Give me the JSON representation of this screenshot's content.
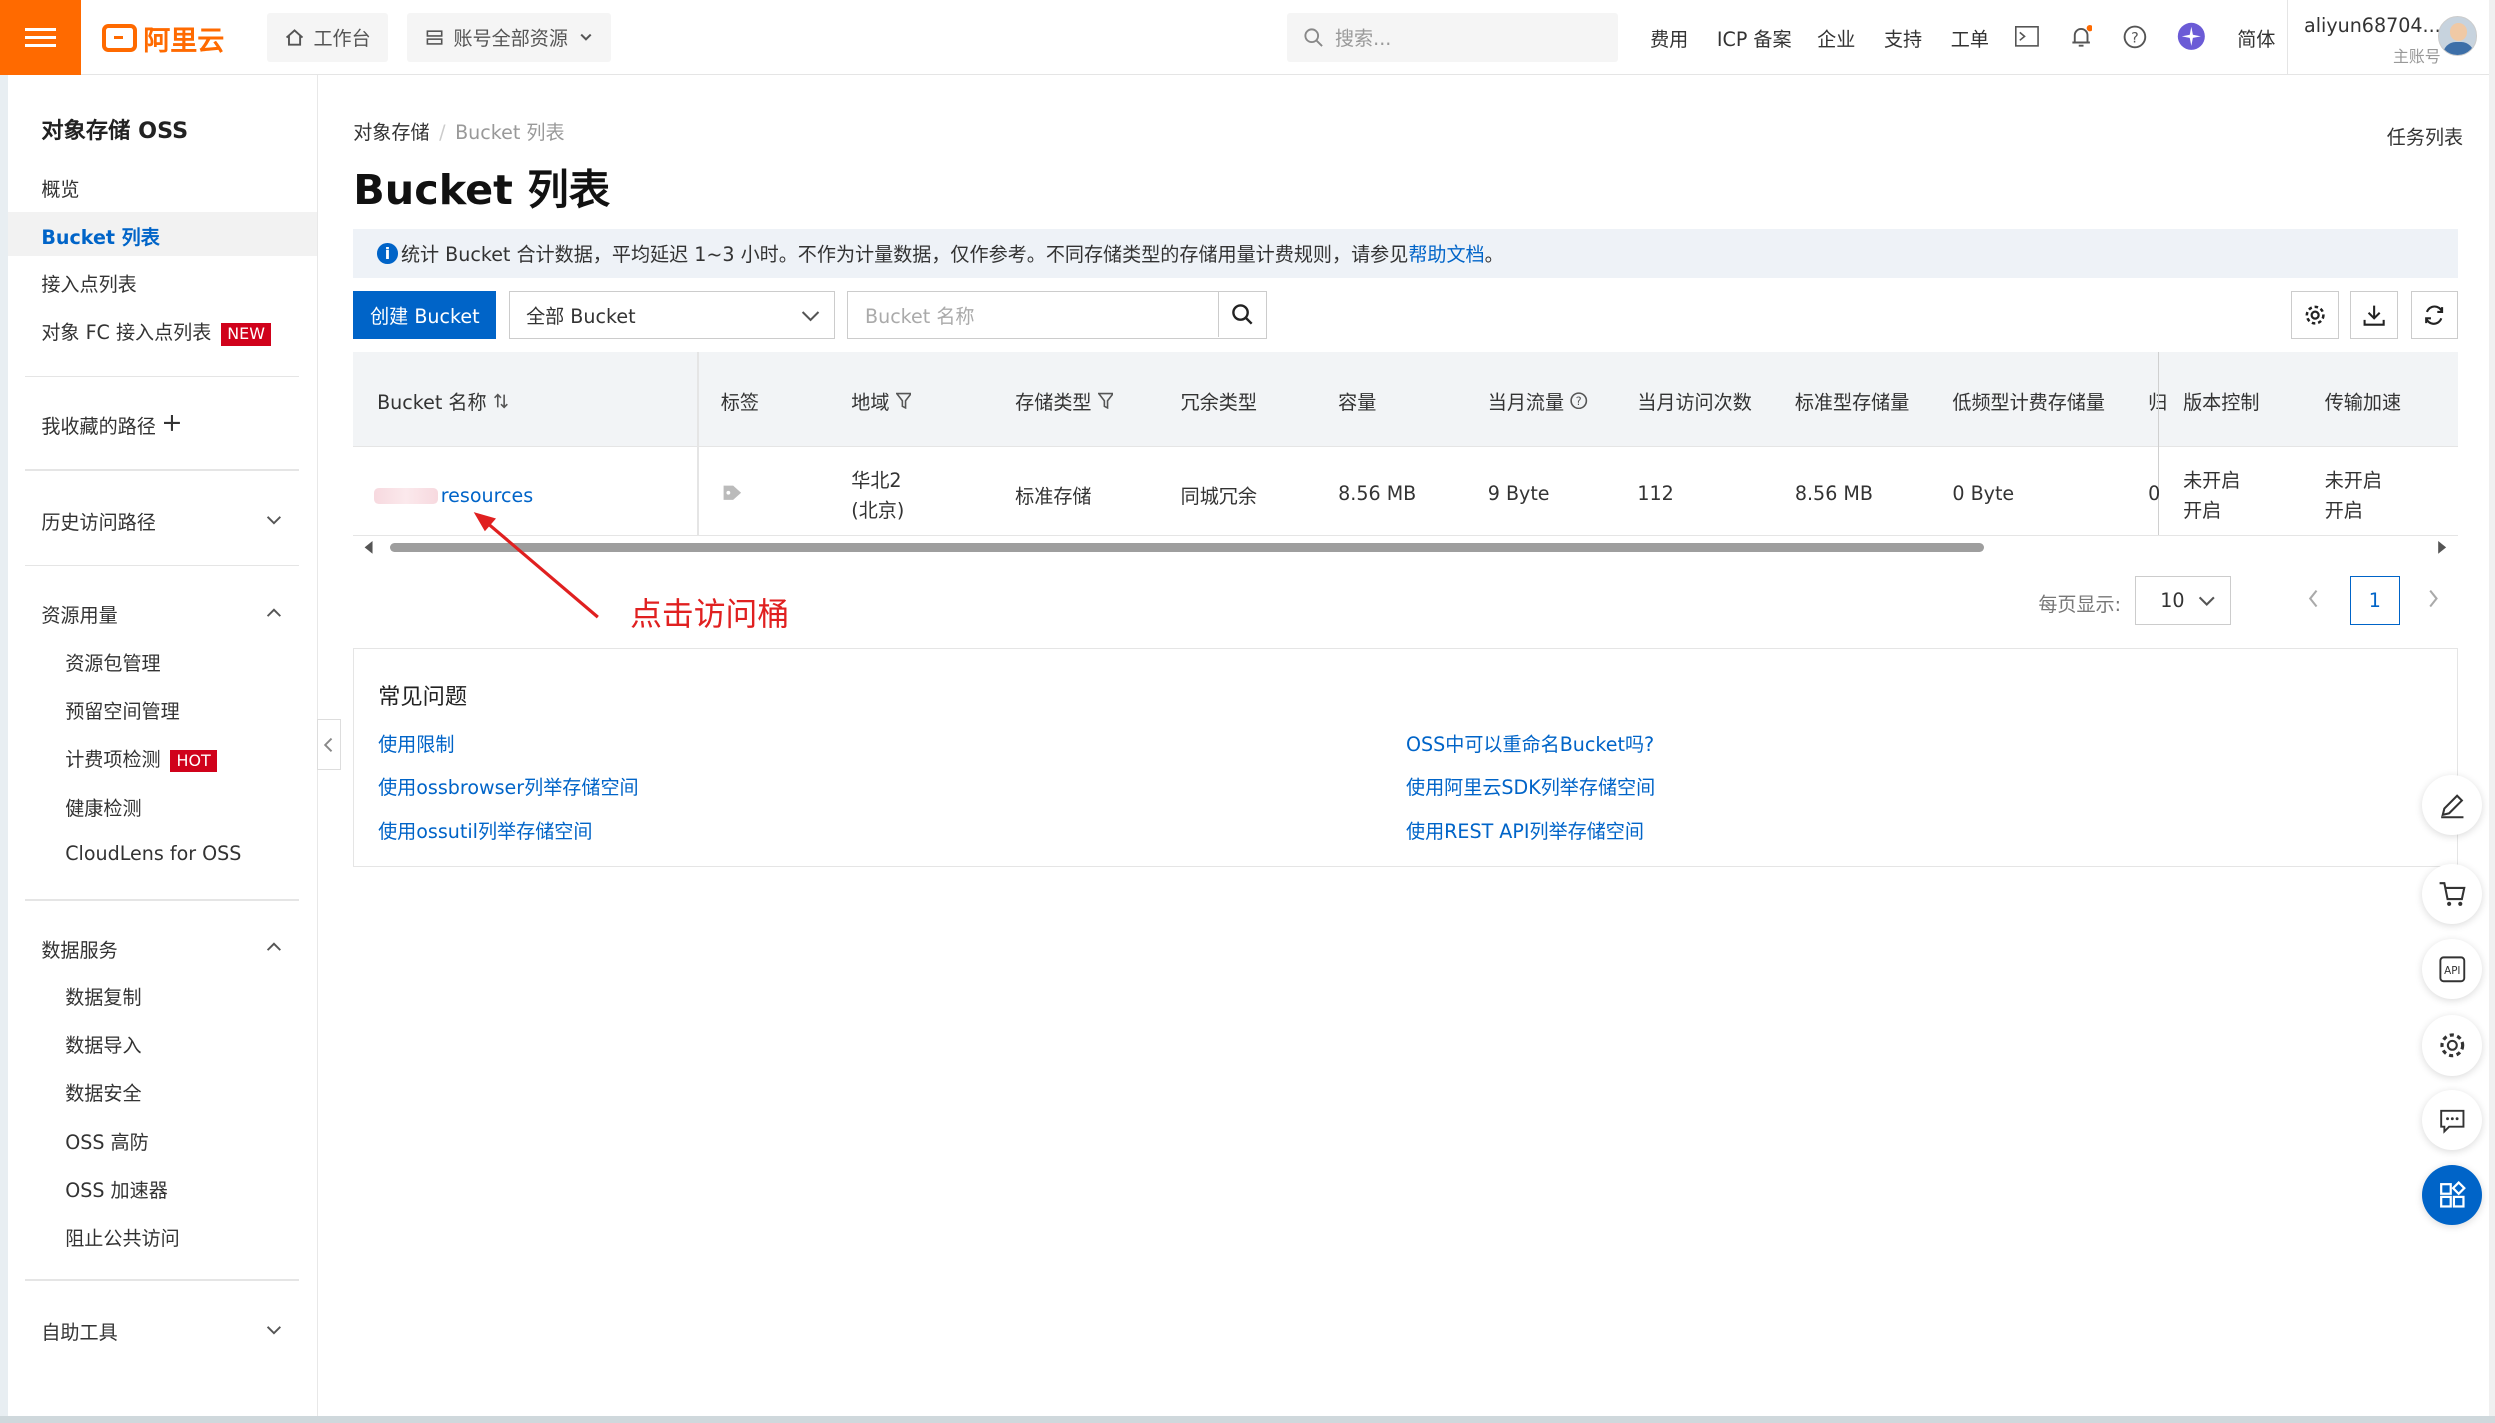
{
  "brand": {
    "logo_text": "阿里云"
  },
  "topbar": {
    "workbench": "工作台",
    "resources": "账号全部资源",
    "search_placeholder": "搜索...",
    "nav": [
      "费用",
      "ICP 备案",
      "企业",
      "支持",
      "工单"
    ],
    "lang": "简体",
    "user_name": "aliyun68704...",
    "user_role": "主账号"
  },
  "sidebar": {
    "title": "对象存储 OSS",
    "items": [
      "概览",
      "Bucket 列表",
      "接入点列表",
      "对象 FC 接入点列表"
    ],
    "new_tag": "NEW",
    "favorites": "我收藏的路径",
    "history": "历史访问路径",
    "usage_group": "资源用量",
    "usage_items": [
      "资源包管理",
      "预留空间管理",
      "计费项检测",
      "健康检测",
      "CloudLens for OSS"
    ],
    "hot_tag": "HOT",
    "data_group": "数据服务",
    "data_items": [
      "数据复制",
      "数据导入",
      "数据安全",
      "OSS 高防",
      "OSS 加速器",
      "阻止公共访问"
    ],
    "tools_group": "自助工具"
  },
  "breadcrumb": {
    "root": "对象存储",
    "current": "Bucket 列表"
  },
  "task_list": "任务列表",
  "page_title": "Bucket 列表",
  "notice": {
    "text": "统计 Bucket 合计数据，平均延迟 1~3 小时。不作为计量数据，仅作参考。不同存储类型的存储用量计费规则，请参见",
    "link": "帮助文档",
    "end": "。"
  },
  "toolbar": {
    "create": "创建 Bucket",
    "filter_selected": "全部 Bucket",
    "name_placeholder": "Bucket 名称"
  },
  "table": {
    "headers": [
      "Bucket 名称",
      "标签",
      "地域",
      "存储类型",
      "冗余类型",
      "容量",
      "当月流量",
      "当月访问次数",
      "标准型存储量",
      "低频型计费存储量",
      "归",
      "版本控制",
      "传输加速"
    ],
    "row": {
      "name": "resources",
      "region_1": "华北2",
      "region_2": "(北京)",
      "storage_class": "标准存储",
      "redundancy": "同城冗余",
      "capacity": "8.56 MB",
      "traffic": "9 Byte",
      "visits": "112",
      "standard": "8.56 MB",
      "ia": "0 Byte",
      "archive": "0",
      "versioning": "未开启",
      "versioning_action": "开启",
      "accel": "未开启",
      "accel_action": "开启"
    }
  },
  "annotation": "点击访问桶",
  "pager": {
    "label": "每页显示:",
    "size": "10",
    "page": "1"
  },
  "faq": {
    "title": "常见问题",
    "left": [
      "使用限制",
      "使用ossbrowser列举存储空间",
      "使用ossutil列举存储空间"
    ],
    "right": [
      "OSS中可以重命名Bucket吗?",
      "使用阿里云SDK列举存储空间",
      "使用REST API列举存储空间"
    ]
  },
  "colors": {
    "brand": "#ff6a00",
    "primary": "#0064c8",
    "annotation": "#e02020",
    "new_tag": "#d0021b"
  }
}
